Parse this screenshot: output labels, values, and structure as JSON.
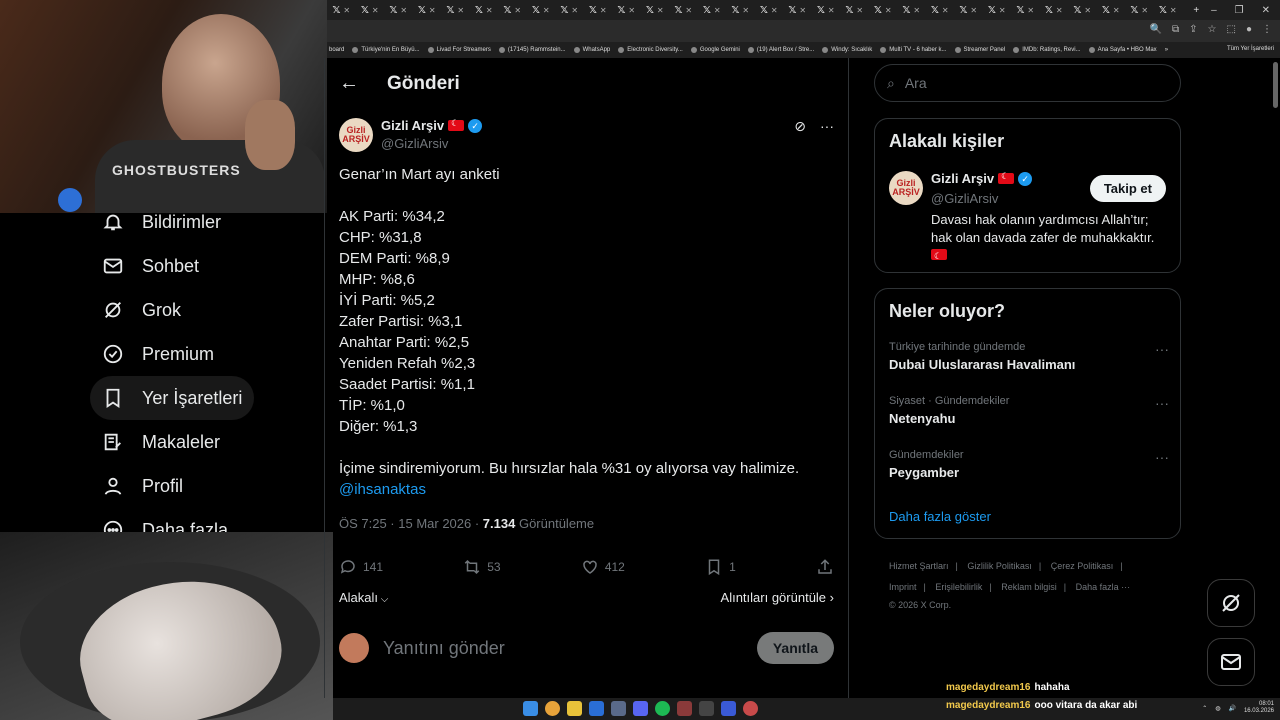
{
  "browser": {
    "tabs": [
      "𝕏",
      "𝕏",
      "𝕏",
      "𝕏",
      "𝕏",
      "𝕏",
      "𝕏",
      "𝕏",
      "𝕏",
      "𝕏",
      "𝕏",
      "𝕏",
      "𝕏",
      "𝕏",
      "𝕏",
      "𝕏",
      "𝕏",
      "𝕏",
      "𝕏",
      "𝕏",
      "𝕏",
      "𝕏",
      "𝕏",
      "𝕏",
      "𝕏",
      "𝕏",
      "𝕏",
      "𝕏",
      "𝕏",
      "𝕏"
    ],
    "new_tab": "+",
    "bookmarks": [
      "board",
      "Türkiye'nin En Büyü...",
      "Livad For Streamers",
      "(17145) Rammstein...",
      "WhatsApp",
      "Electronic Diversity...",
      "Google Gemini",
      "(19) Alert Box / Stre...",
      "Windy: Sıcaklık",
      "Multi TV - 6 haber k...",
      "Streamer Panel",
      "IMDb: Ratings, Revi...",
      "Ana Sayfa • HBO Max"
    ],
    "bookmarks_more": "»",
    "all_bookmarks": "Tüm Yer İşaretleri"
  },
  "cam": {
    "shirt_text": "GHOSTBUSTERS"
  },
  "nav": {
    "items": [
      {
        "label": "Bildirimler",
        "icon": "bell-icon"
      },
      {
        "label": "Sohbet",
        "icon": "mail-icon"
      },
      {
        "label": "Grok",
        "icon": "grok-icon"
      },
      {
        "label": "Premium",
        "icon": "premium-icon"
      },
      {
        "label": "Yer İşaretleri",
        "icon": "bookmark-icon"
      },
      {
        "label": "Makaleler",
        "icon": "article-icon"
      },
      {
        "label": "Profil",
        "icon": "profile-icon"
      },
      {
        "label": "Daha fazla",
        "icon": "more-icon"
      }
    ]
  },
  "post": {
    "header_title": "Gönderi",
    "author_name": "Gizli Arşiv",
    "author_handle": "@GizliArsiv",
    "avatar_text": "Gizli ARŞİV",
    "lines": [
      "Genar’ın Mart ayı anketi",
      "",
      "AK Parti: %34,2",
      "CHP: %31,8",
      "DEM Parti: %8,9",
      "MHP: %8,6",
      "İYİ Parti: %5,2",
      "Zafer Partisi: %3,1",
      "Anahtar Parti: %2,5",
      "Yeniden Refah %2,3",
      "Saadet Partisi: %1,1",
      "TİP: %1,0",
      "Diğer: %1,3",
      "",
      "İçime sindiremiyorum. Bu hırsızlar hala %31 oy alıyorsa vay halimize."
    ],
    "mention": "@ihsanaktas",
    "time": "ÖS 7:25 · 15 Mar 2026 · ",
    "views_count": "7.134",
    "views_label": " Görüntüleme",
    "replies": "141",
    "reposts": "53",
    "likes": "412",
    "bookmarks": "1",
    "relevance": "Alakalı",
    "quotes": "Alıntıları görüntüle",
    "reply_placeholder": "Yanıtını gönder",
    "reply_button": "Yanıtla"
  },
  "right": {
    "search_placeholder": "Ara",
    "related_title": "Alakalı kişiler",
    "related_name": "Gizli Arşiv",
    "related_handle": "@GizliArsiv",
    "follow": "Takip et",
    "related_bio": "Davası hak olanın yardımcısı Allah’tır; hak olan davada zafer de muhakkaktır.",
    "trends_title": "Neler oluyor?",
    "trends": [
      {
        "context": "Türkiye tarihinde gündemde",
        "topic": "Dubai Uluslararası Havalimanı"
      },
      {
        "context": "Siyaset · Gündemdekiler",
        "topic": "Netenyahu"
      },
      {
        "context": "Gündemdekiler",
        "topic": "Peygamber"
      }
    ],
    "show_more": "Daha fazla göster",
    "footer_line1": [
      "Hizmet Şartları",
      "Gizlilik Politikası",
      "Çerez Politikası"
    ],
    "footer_line2": [
      "Imprint",
      "Erişilebilirlik",
      "Reklam bilgisi",
      "Daha fazla ···"
    ],
    "copyright": "© 2026 X Corp."
  },
  "chat": [
    {
      "user": "magedaydream16",
      "text": "hahaha"
    },
    {
      "user": "magedaydream16",
      "text": "ooo vitara da akar abi"
    }
  ],
  "clock": {
    "time": "08:01",
    "date": "16.03.2026"
  },
  "colors": {
    "accent": "#1d9bf0",
    "border": "#2f3336",
    "muted": "#71767b",
    "chat_user": "#f2c94c"
  }
}
